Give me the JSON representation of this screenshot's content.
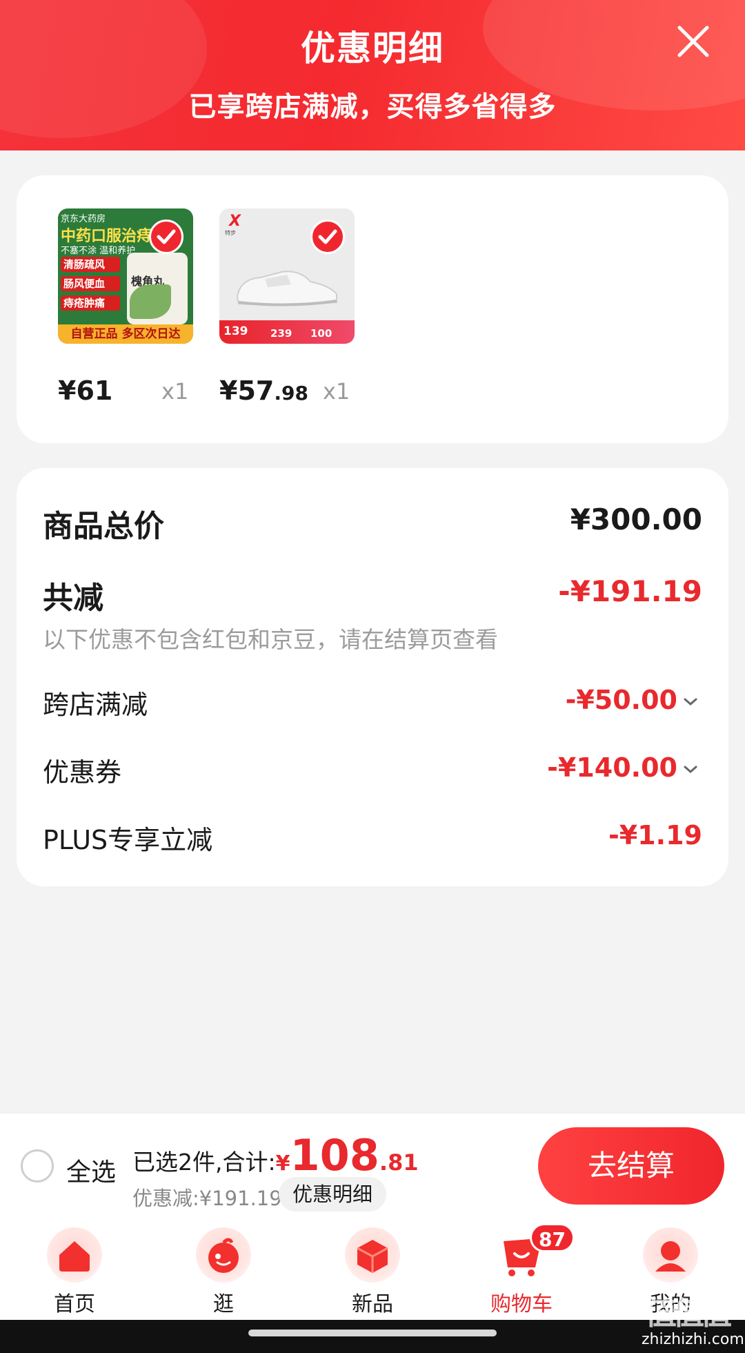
{
  "header": {
    "title": "优惠明细",
    "subtitle": "已享跨店满减，买得多省得多"
  },
  "products": [
    {
      "price_int": "¥61",
      "price_dec": "",
      "qty": "x1",
      "thumb": {
        "brand": "京东大药房",
        "headline": "中药口服治痔疮",
        "subline": "不塞不涂 温和养护",
        "tags": [
          "清肠疏风",
          "肠风便血",
          "痔疮肿痛"
        ],
        "bottle_label": "槐角丸",
        "footer": "自营正品 多区次日达"
      }
    },
    {
      "price_int": "¥57",
      "price_dec": ".98",
      "qty": "x1",
      "thumb": {
        "logo": "X",
        "brand": "特步",
        "prices": [
          "139",
          "239",
          "100"
        ]
      }
    }
  ],
  "summary": {
    "total_label": "商品总价",
    "total_value": "¥300.00",
    "reduce_label": "共减",
    "reduce_value": "-¥191.19",
    "note": "以下优惠不包含红包和京豆，请在结算页查看",
    "items": [
      {
        "label": "跨店满减",
        "value": "-¥50.00",
        "expandable": true
      },
      {
        "label": "优惠券",
        "value": "-¥140.00",
        "expandable": true
      },
      {
        "label": "PLUS专享立减",
        "value": "-¥1.19",
        "expandable": false
      }
    ]
  },
  "checkout": {
    "select_all": "全选",
    "selected_text": "已选2件,合计:",
    "currency": "¥",
    "total_int": "108",
    "total_dec": ".81",
    "discount_text": "优惠减:¥191.19",
    "detail_button": "优惠明细",
    "checkout_button": "去结算"
  },
  "tabs": [
    {
      "label": "首页",
      "icon": "home-icon"
    },
    {
      "label": "逛",
      "icon": "browse-icon"
    },
    {
      "label": "新品",
      "icon": "new-product-icon"
    },
    {
      "label": "购物车",
      "icon": "cart-icon",
      "active": true,
      "badge": "87"
    },
    {
      "label": "我的",
      "icon": "profile-icon"
    }
  ],
  "watermark": {
    "logo": "值值值",
    "text": "zhizhizhi.com"
  },
  "colors": {
    "accent": "#e8292d",
    "header": "#f42a2f"
  }
}
